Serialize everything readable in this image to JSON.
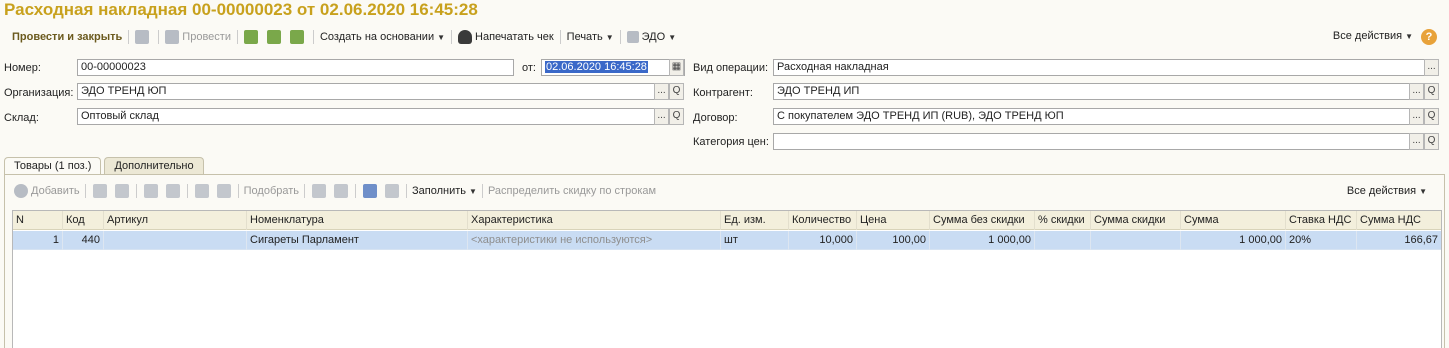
{
  "window": {
    "title": "Расходная накладная 00-00000023 от 02.06.2020 16:45:28"
  },
  "toolbar": {
    "post_close": "Провести и закрыть",
    "post": "Провести",
    "create_basis": "Создать на основании",
    "print_receipt": "Напечатать чек",
    "print": "Печать",
    "edo": "ЭДО",
    "all_actions": "Все действия",
    "help": "?"
  },
  "form": {
    "number_label": "Номер:",
    "number_value": "00-00000023",
    "date_label": "от:",
    "date_value": "02.06.2020 16:45:28",
    "org_label": "Организация:",
    "org_value": "ЭДО ТРЕНД ЮП",
    "warehouse_label": "Склад:",
    "warehouse_value": "Оптовый склад",
    "operation_label": "Вид операции:",
    "operation_value": "Расходная накладная",
    "contractor_label": "Контрагент:",
    "contractor_value": "ЭДО ТРЕНД ИП",
    "contract_label": "Договор:",
    "contract_value": "С покупателем ЭДО ТРЕНД ИП (RUB), ЭДО ТРЕНД ЮП",
    "price_cat_label": "Категория цен:",
    "price_cat_value": "",
    "ellipsis": "...",
    "search": "Q"
  },
  "tabs": [
    {
      "label": "Товары (1 поз.)"
    },
    {
      "label": "Дополнительно"
    }
  ],
  "goods_toolbar": {
    "add": "Добавить",
    "pick": "Подобрать",
    "fill": "Заполнить",
    "distribute": "Распределить скидку по строкам",
    "all_actions": "Все действия"
  },
  "table": {
    "columns": [
      "N",
      "Код",
      "Артикул",
      "Номенклатура",
      "Характеристика",
      "Ед. изм.",
      "Количество",
      "Цена",
      "Сумма без скидки",
      "% скидки",
      "Сумма скидки",
      "Сумма",
      "Ставка НДС",
      "Сумма НДС"
    ],
    "rows": [
      [
        "1",
        "440",
        "",
        "Сигареты Парламент",
        "<характеристики не используются>",
        "шт",
        "10,000",
        "100,00",
        "1 000,00",
        "",
        "",
        "1 000,00",
        "20%",
        "166,67"
      ]
    ]
  }
}
